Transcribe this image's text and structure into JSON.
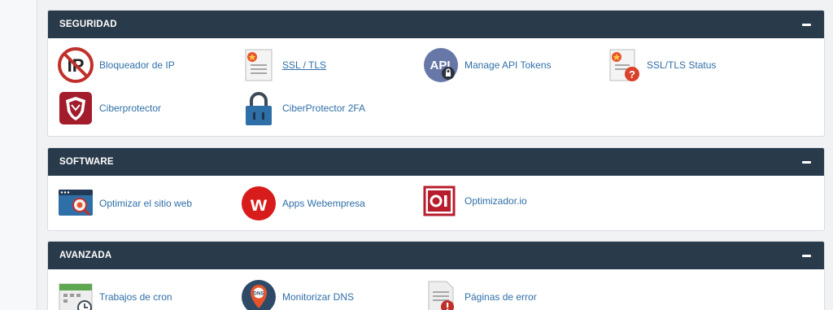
{
  "seguridad": {
    "title": "SEGURIDAD",
    "items": [
      {
        "label": "Bloqueador de IP",
        "icon": "ip-blocker-icon"
      },
      {
        "label": "SSL / TLS",
        "icon": "certificate-icon"
      },
      {
        "label": "Manage API Tokens",
        "icon": "api-token-icon"
      },
      {
        "label": "SSL/TLS Status",
        "icon": "certificate-status-icon"
      },
      {
        "label": "Ciberprotector",
        "icon": "shield-icon"
      },
      {
        "label": "CiberProtector 2FA",
        "icon": "padlock-icon"
      }
    ]
  },
  "software": {
    "title": "SOFTWARE",
    "items": [
      {
        "label": "Optimizar el sitio web",
        "icon": "website-optimize-icon"
      },
      {
        "label": "Apps Webempresa",
        "icon": "webempresa-logo-icon"
      },
      {
        "label": "Optimizador.io",
        "icon": "optimizador-logo-icon"
      }
    ]
  },
  "avanzada": {
    "title": "AVANZADA",
    "items": [
      {
        "label": "Trabajos de cron",
        "icon": "calendar-clock-icon"
      },
      {
        "label": "Monitorizar DNS",
        "icon": "dns-pin-icon"
      },
      {
        "label": "Páginas de error",
        "icon": "error-page-icon"
      }
    ]
  },
  "colors": {
    "header_bg": "#293a4a",
    "link": "#2f6fa7",
    "page_bg": "#f0f2f4"
  }
}
